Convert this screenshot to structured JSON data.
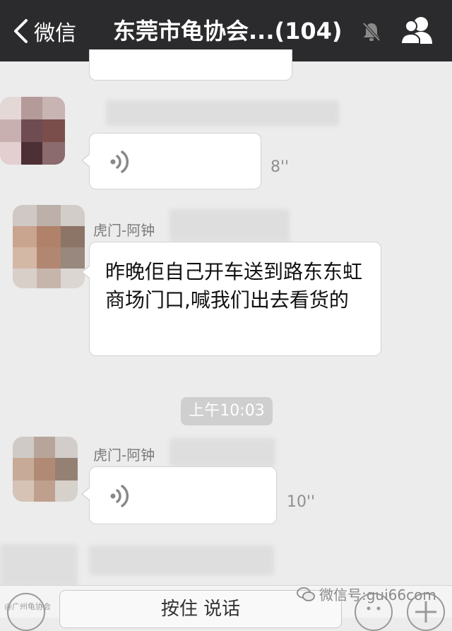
{
  "header": {
    "back_label": "微信",
    "title": "东莞市龟协会...(104)",
    "mute_icon": "mute-bell-icon",
    "group_icon": "group-members-icon"
  },
  "messages": [
    {
      "type": "voice",
      "sender": "",
      "duration": "8''"
    },
    {
      "type": "text",
      "sender": "虎门-阿钟",
      "text": "昨晚佢自己开车送到路东东虹商场门口,喊我们出去看货的"
    },
    {
      "type": "time",
      "text": "上午10:03"
    },
    {
      "type": "voice",
      "sender": "虎门-阿钟",
      "duration": "10''"
    }
  ],
  "input_bar": {
    "hold_to_talk": "按住 说话"
  },
  "watermark": "微信号:gui66com",
  "corner_mark": "@广州龟协会"
}
